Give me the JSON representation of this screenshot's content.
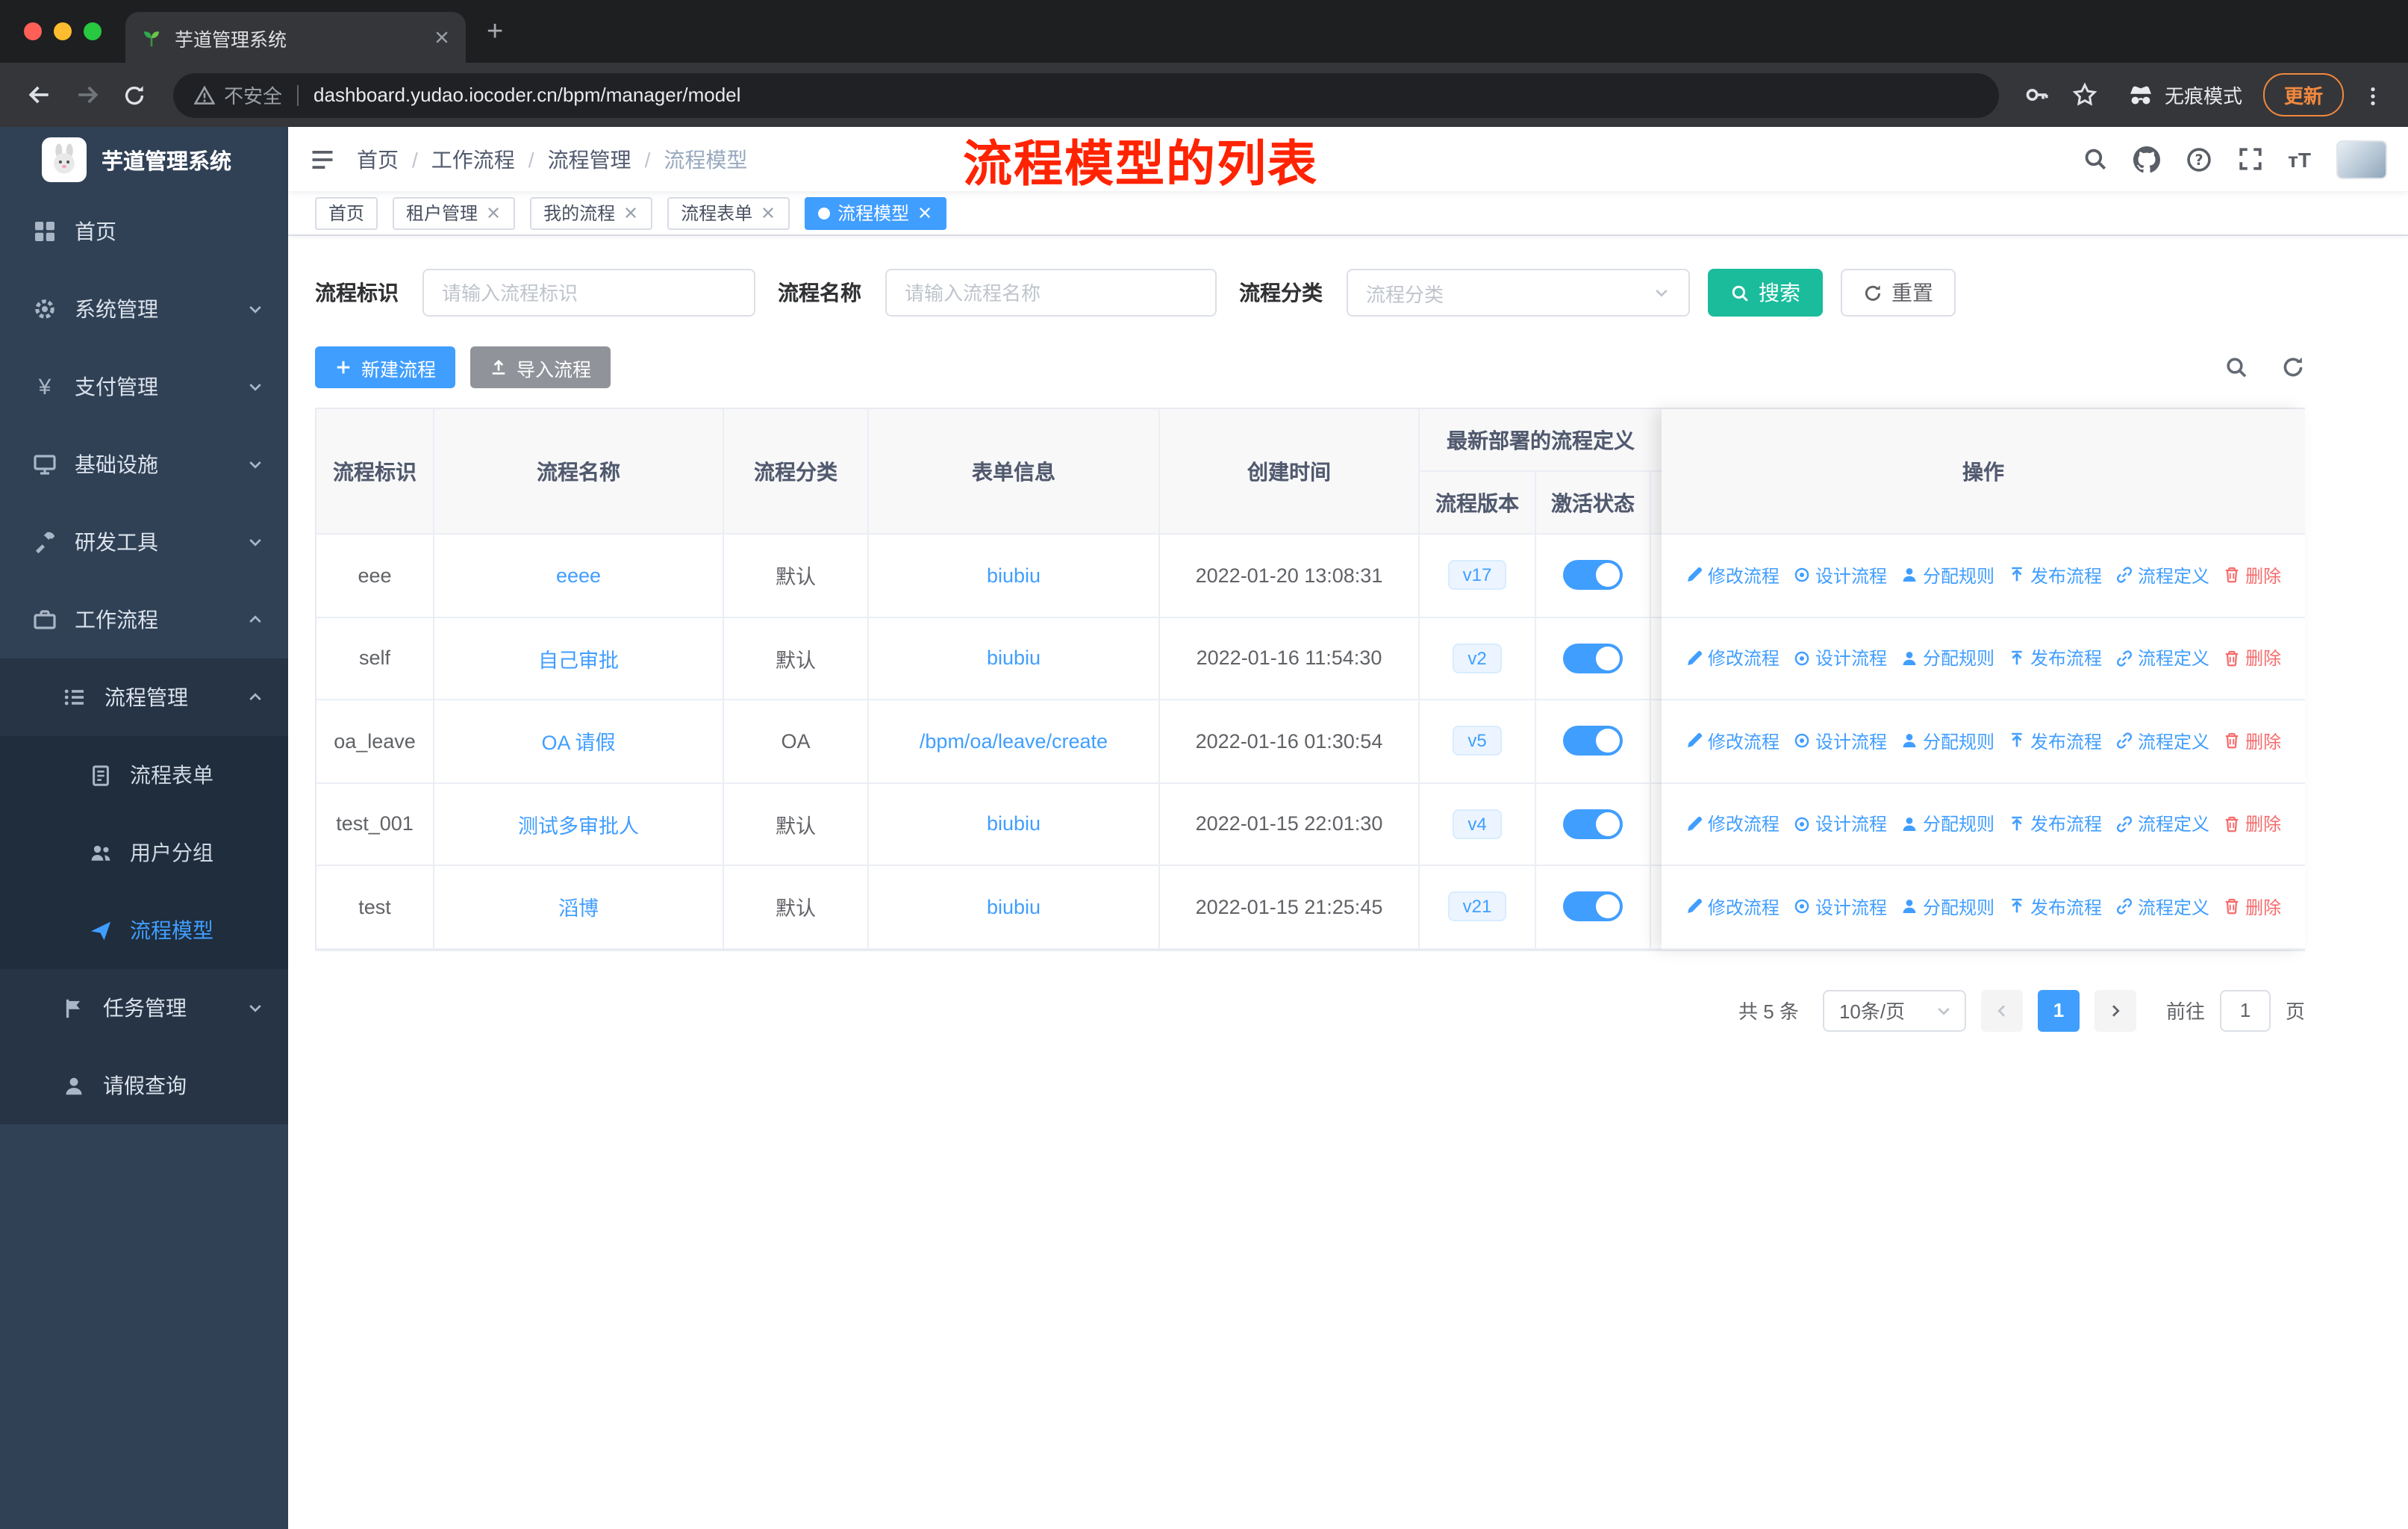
{
  "browser": {
    "tab_title": "芋道管理系统",
    "security_text": "不安全",
    "url": "dashboard.yudao.iocoder.cn/bpm/manager/model",
    "incognito_text": "无痕模式",
    "update_text": "更新"
  },
  "sidebar": {
    "title": "芋道管理系统",
    "menu": [
      {
        "label": "首页"
      },
      {
        "label": "系统管理"
      },
      {
        "label": "支付管理"
      },
      {
        "label": "基础设施"
      },
      {
        "label": "研发工具"
      },
      {
        "label": "工作流程"
      },
      {
        "label": "流程管理"
      },
      {
        "label": "流程表单"
      },
      {
        "label": "用户分组"
      },
      {
        "label": "流程模型"
      },
      {
        "label": "任务管理"
      },
      {
        "label": "请假查询"
      }
    ]
  },
  "navbar": {
    "breadcrumb": [
      "首页",
      "工作流程",
      "流程管理",
      "流程模型"
    ],
    "annotation": "流程模型的列表"
  },
  "tags": [
    {
      "label": "首页"
    },
    {
      "label": "租户管理"
    },
    {
      "label": "我的流程"
    },
    {
      "label": "流程表单"
    },
    {
      "label": "流程模型"
    }
  ],
  "filters": {
    "key_label": "流程标识",
    "key_placeholder": "请输入流程标识",
    "name_label": "流程名称",
    "name_placeholder": "请输入流程名称",
    "category_label": "流程分类",
    "category_placeholder": "流程分类",
    "search_label": "搜索",
    "reset_label": "重置"
  },
  "toolbar": {
    "create_label": "新建流程",
    "import_label": "导入流程"
  },
  "table": {
    "headers": {
      "key": "流程标识",
      "name": "流程名称",
      "category": "流程分类",
      "form": "表单信息",
      "created": "创建时间",
      "deploy_group": "最新部署的流程定义",
      "version": "流程版本",
      "status": "激活状态",
      "actions": "操作"
    },
    "rows": [
      {
        "key": "eee",
        "name": "eeee",
        "category": "默认",
        "form": "biubiu",
        "created": "2022-01-20 13:08:31",
        "version": "v17"
      },
      {
        "key": "self",
        "name": "自己审批",
        "category": "默认",
        "form": "biubiu",
        "created": "2022-01-16 11:54:30",
        "version": "v2"
      },
      {
        "key": "oa_leave",
        "name": "OA 请假",
        "category": "OA",
        "form": "/bpm/oa/leave/create",
        "created": "2022-01-16 01:30:54",
        "version": "v5"
      },
      {
        "key": "test_001",
        "name": "测试多审批人",
        "category": "默认",
        "form": "biubiu",
        "created": "2022-01-15 22:01:30",
        "version": "v4"
      },
      {
        "key": "test",
        "name": "滔博",
        "category": "默认",
        "form": "biubiu",
        "created": "2022-01-15 21:25:45",
        "version": "v21"
      }
    ],
    "row_actions": [
      "修改流程",
      "设计流程",
      "分配规则",
      "发布流程",
      "流程定义",
      "删除"
    ]
  },
  "pagination": {
    "total": "共 5 条",
    "page_size": "10条/页",
    "page": "1",
    "goto_label": "前往",
    "page_unit": "页",
    "goto_value": "1"
  }
}
